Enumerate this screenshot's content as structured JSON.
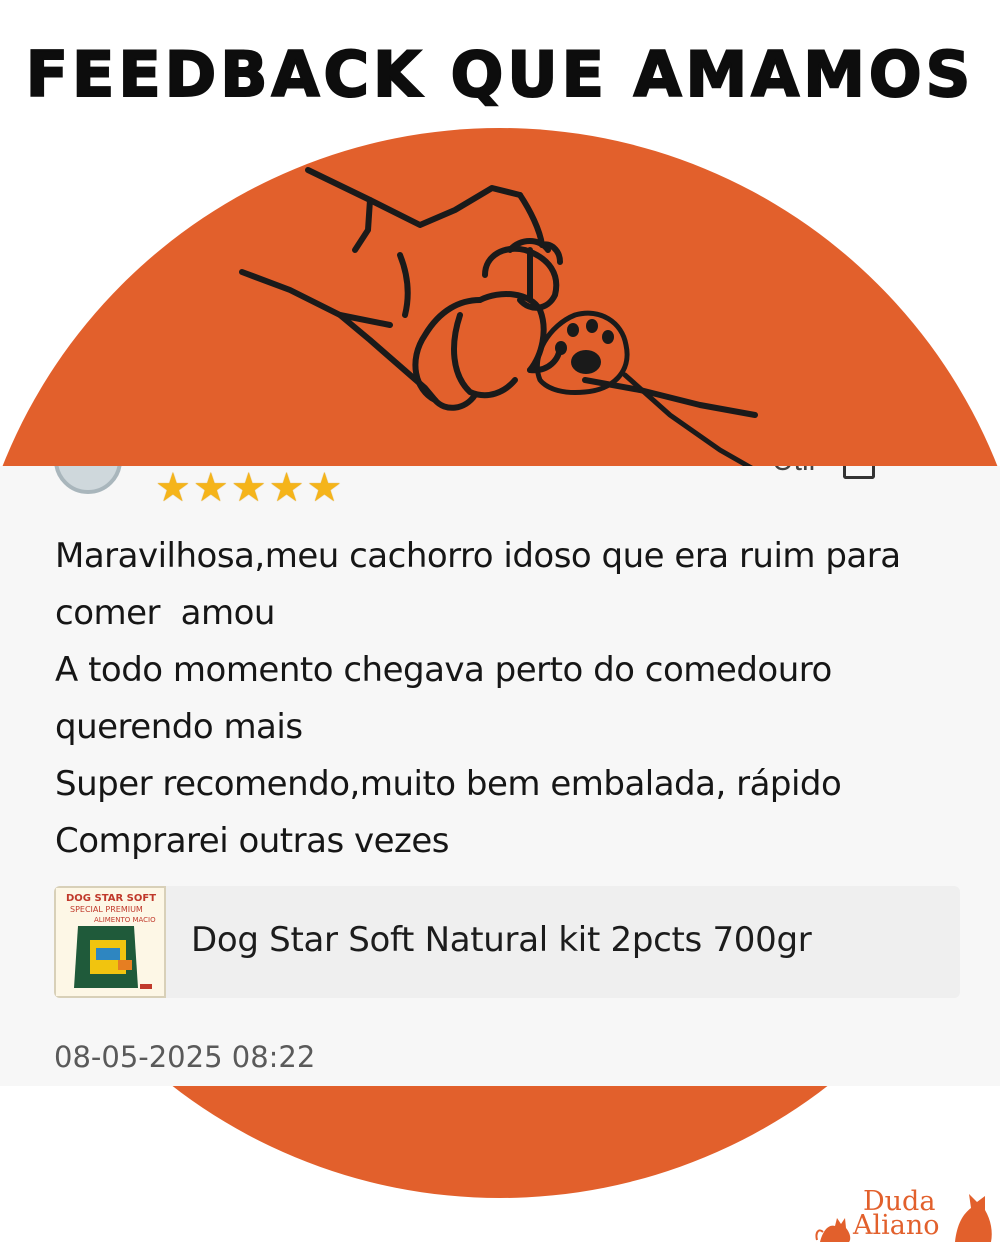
{
  "headline": "FEEDBACK QUE AMAMOS",
  "colors": {
    "accent": "#e2602c",
    "star": "#f5b41a",
    "card": "#f7f7f7"
  },
  "review": {
    "partial_top_text": "Útil",
    "rating": 5,
    "lines": [
      "Maravilhosa,meu cachorro idoso que era ruim para",
      "comer  amou",
      "A todo momento chegava perto do comedouro",
      "querendo mais",
      "Super recomendo,muito bem embalada, rápido",
      "Comprarei outras vezes"
    ],
    "product": {
      "name": "Dog Star Soft Natural kit 2pcts 700gr",
      "thumbnail_text": [
        "DOG STAR SOFT",
        "SPECIAL PREMIUM",
        "ALIMENTO MACIO"
      ]
    },
    "date": "08-05-2025 08:22"
  },
  "logo": {
    "line1": "Duda",
    "line2": "Aliano"
  }
}
